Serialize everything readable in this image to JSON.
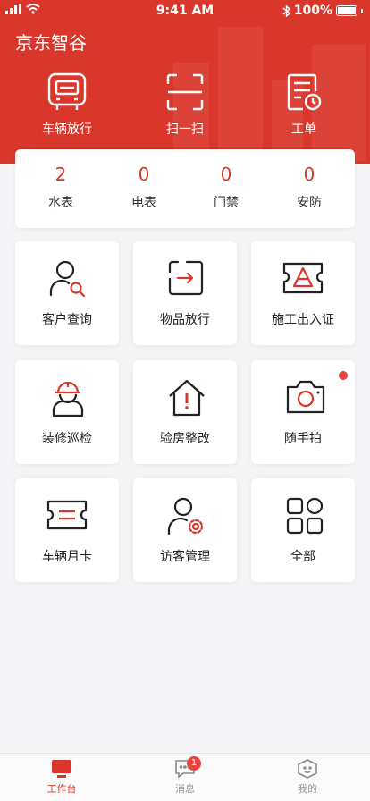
{
  "status_bar": {
    "time": "9:41 AM",
    "battery": "100%"
  },
  "app": {
    "title": "京东智谷"
  },
  "quick_actions": [
    {
      "label": "车辆放行",
      "icon": "vehicle-pass-icon"
    },
    {
      "label": "扫一扫",
      "icon": "scan-icon"
    },
    {
      "label": "工单",
      "icon": "work-order-icon"
    }
  ],
  "meters": [
    {
      "count": "2",
      "label": "水表"
    },
    {
      "count": "0",
      "label": "电表"
    },
    {
      "count": "0",
      "label": "门禁"
    },
    {
      "count": "0",
      "label": "安防"
    }
  ],
  "tiles": [
    {
      "label": "客户查询",
      "icon": "customer-search-icon"
    },
    {
      "label": "物品放行",
      "icon": "item-release-icon"
    },
    {
      "label": "施工出入证",
      "icon": "construction-pass-icon"
    },
    {
      "label": "装修巡检",
      "icon": "decoration-inspection-icon"
    },
    {
      "label": "验房整改",
      "icon": "house-inspection-icon"
    },
    {
      "label": "随手拍",
      "icon": "camera-icon",
      "has_dot": true
    },
    {
      "label": "车辆月卡",
      "icon": "monthly-card-icon"
    },
    {
      "label": "访客管理",
      "icon": "visitor-manage-icon"
    },
    {
      "label": "全部",
      "icon": "all-apps-icon"
    }
  ],
  "tabbar": [
    {
      "label": "工作台",
      "icon": "workbench-icon",
      "active": true
    },
    {
      "label": "消息",
      "icon": "message-icon",
      "badge": "1"
    },
    {
      "label": "我的",
      "icon": "profile-icon"
    }
  ],
  "colors": {
    "accent": "#d9372b",
    "badge": "#e84343",
    "background": "#f5f5f7"
  }
}
